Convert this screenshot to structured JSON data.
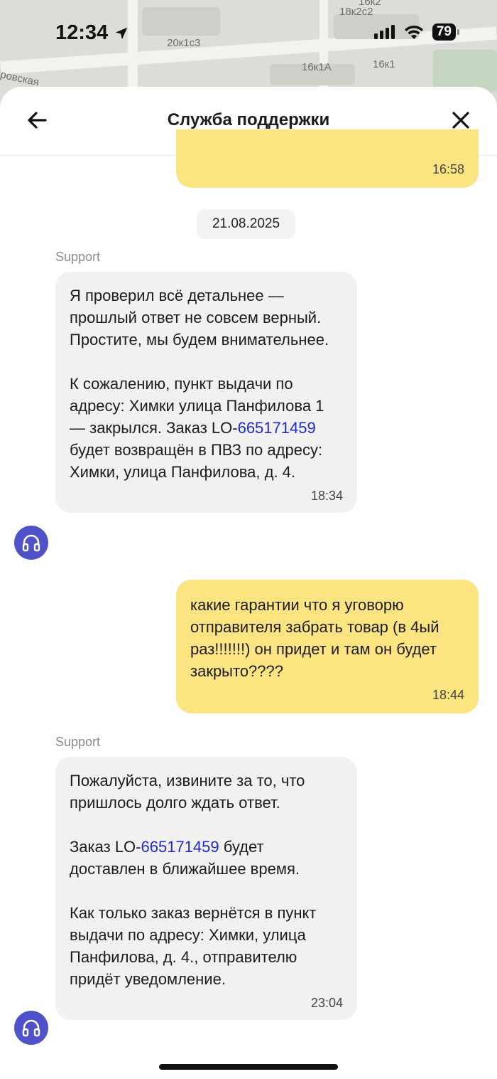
{
  "status_bar": {
    "time": "12:34",
    "battery": "79"
  },
  "map": {
    "labels": [
      "16к2",
      "18к2с2",
      "20к1с3",
      "16к1А",
      "16к1",
      "ровская"
    ]
  },
  "header": {
    "title": "Служба поддержки"
  },
  "messages": {
    "m0": {
      "time": "16:58"
    },
    "date_divider": "21.08.2025",
    "m1": {
      "sender": "Support",
      "para1": "Я проверил всё детальнее — прошлый ответ не совсем верный. Простите, мы будем внимательнее.",
      "para2_pre": "К сожалению, пункт выдачи по адресу: Химки улица Панфилова 1 — закрылся. Заказ LO-",
      "para2_link": "665171459",
      "para2_post": " будет возвращён в ПВЗ по адресу: Химки, улица Панфилова, д. 4.",
      "time": "18:34"
    },
    "m2": {
      "text": "какие гарантии что я уговорю отправителя забрать товар (в 4ый раз!!!!!!!) он придет и там он будет закрыто????",
      "time": "18:44"
    },
    "m3": {
      "sender": "Support",
      "para1": "Пожалуйста, извините за то, что пришлось долго ждать ответ.",
      "para2_pre": "Заказ LO-",
      "para2_link": "665171459",
      "para2_post": " будет доставлен в ближайшее время.",
      "para3": "Как только заказ вернётся в пункт выдачи по адресу: Химки, улица Панфилова, д. 4., отправителю придёт уведомление.",
      "time": "23:04"
    }
  },
  "colors": {
    "user_bubble": "#fce480",
    "support_bubble": "#f2f1ef",
    "link": "#1e2ccf",
    "avatar": "#4f52c9"
  },
  "icons": [
    "location-arrow-icon",
    "signal-icon",
    "wifi-icon",
    "battery-icon",
    "back-arrow-icon",
    "close-icon",
    "headphones-icon"
  ]
}
